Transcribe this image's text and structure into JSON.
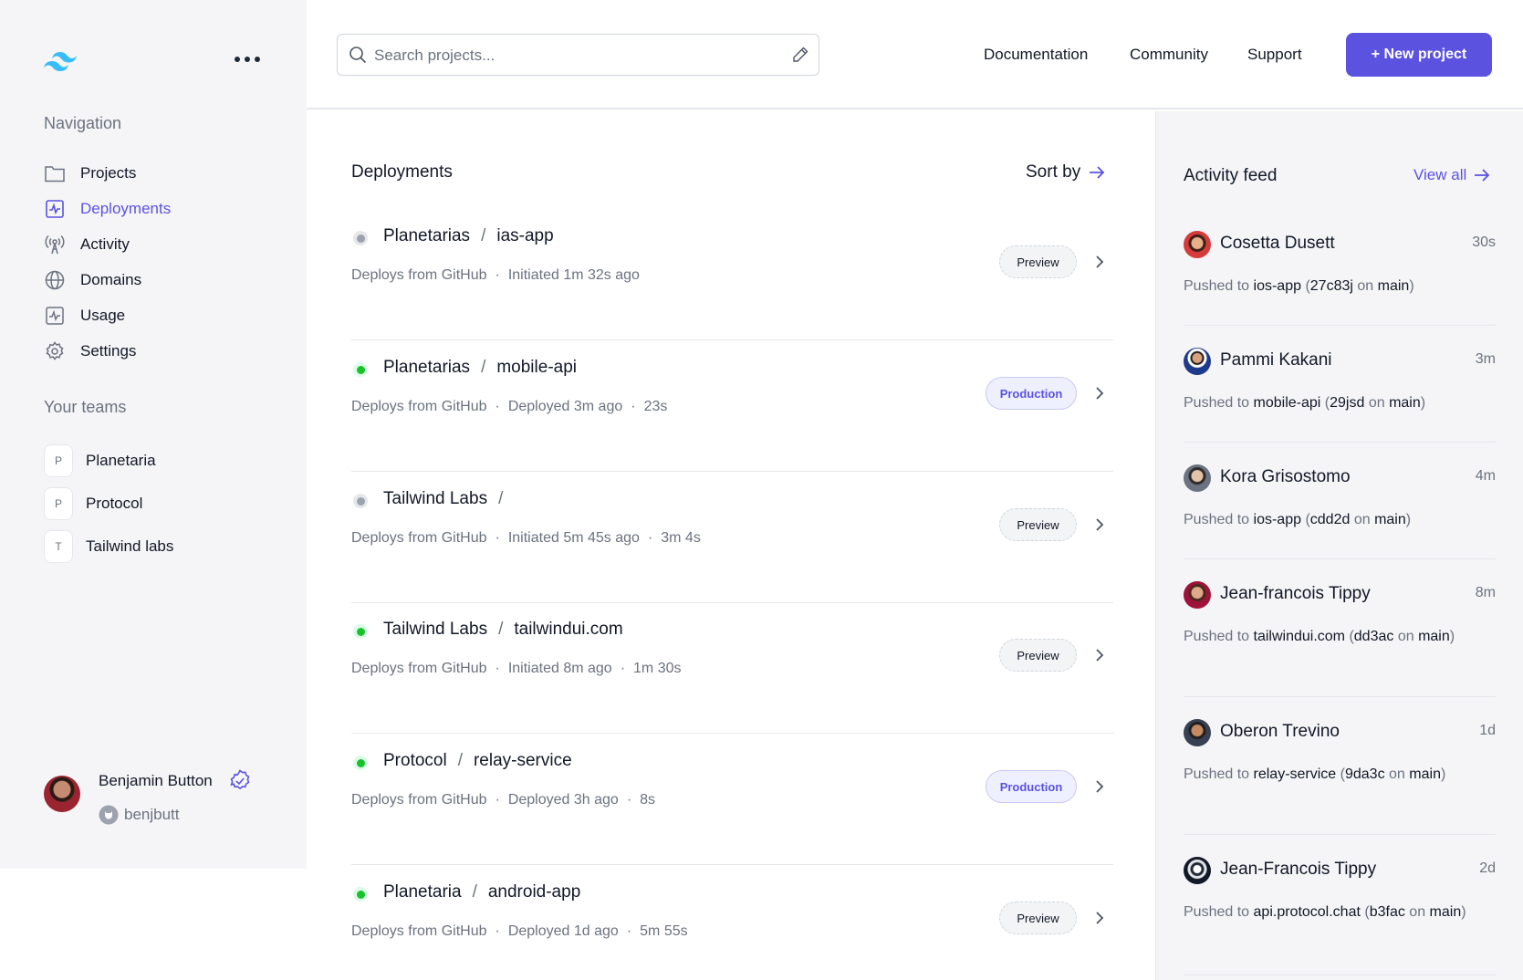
{
  "colors": {
    "accent": "#5b52e0",
    "status_green": "#16c329",
    "status_gray": "#9ca3af"
  },
  "sidebar": {
    "logo_icon": "tailwind-logo",
    "more_icon": "ellipsis-icon",
    "nav_heading": "Navigation",
    "nav": [
      {
        "label": "Projects",
        "icon": "folder-icon"
      },
      {
        "label": "Deployments",
        "icon": "pulse-icon",
        "active": true
      },
      {
        "label": "Activity",
        "icon": "signal-icon"
      },
      {
        "label": "Domains",
        "icon": "globe-icon"
      },
      {
        "label": "Usage",
        "icon": "chart-icon"
      },
      {
        "label": "Settings",
        "icon": "gear-icon"
      }
    ],
    "teams_heading": "Your teams",
    "teams": [
      {
        "initial": "P",
        "label": "Planetaria"
      },
      {
        "initial": "P",
        "label": "Protocol"
      },
      {
        "initial": "T",
        "label": "Tailwind labs"
      }
    ],
    "user": {
      "name": "Benjamin Button",
      "handle": "benjbutt"
    }
  },
  "header": {
    "search_placeholder": "Search projects...",
    "links": [
      "Documentation",
      "Community",
      "Support"
    ],
    "new_button": "+ New project"
  },
  "deployments": {
    "title": "Deployments",
    "sort_label": "Sort by",
    "rows": [
      {
        "team": "Planetarias",
        "project": "ias-app",
        "status": "gray",
        "meta": [
          "Deploys from GitHub",
          "Initiated 1m 32s ago"
        ],
        "badge": "Preview"
      },
      {
        "team": "Planetarias",
        "project": "mobile-api",
        "status": "green",
        "meta": [
          "Deploys from GitHub",
          "Deployed 3m ago",
          "23s"
        ],
        "badge": "Production"
      },
      {
        "team": "Tailwind Labs",
        "project": "",
        "status": "gray",
        "meta": [
          "Deploys from GitHub",
          "Initiated 5m 45s ago",
          "3m 4s"
        ],
        "badge": "Preview"
      },
      {
        "team": "Tailwind Labs",
        "project": "tailwindui.com",
        "status": "green",
        "meta": [
          "Deploys from GitHub",
          "Initiated 8m ago",
          "1m 30s"
        ],
        "badge": "Preview"
      },
      {
        "team": "Protocol",
        "project": "relay-service",
        "status": "green",
        "meta": [
          "Deploys from GitHub",
          "Deployed 3h ago",
          "8s"
        ],
        "badge": "Production"
      },
      {
        "team": "Planetaria",
        "project": "android-app",
        "status": "green",
        "meta": [
          "Deploys from GitHub",
          "Deployed 1d ago",
          "5m 55s"
        ],
        "badge": "Preview"
      }
    ]
  },
  "feed": {
    "title": "Activity feed",
    "view_all": "View all",
    "pushed_to": "Pushed to",
    "on": "on",
    "items": [
      {
        "name": "Cosetta Dusett",
        "time": "30s",
        "project": "ios-app",
        "commit": "27c83j",
        "branch": "main"
      },
      {
        "name": "Pammi Kakani",
        "time": "3m",
        "project": "mobile-api",
        "commit": "29jsd",
        "branch": "main"
      },
      {
        "name": "Kora Grisostomo",
        "time": "4m",
        "project": "ios-app",
        "commit": "cdd2d",
        "branch": "main"
      },
      {
        "name": "Jean-francois Tippy",
        "time": "8m",
        "project": "tailwindui.com",
        "commit": "dd3ac",
        "branch": "main"
      },
      {
        "name": "Oberon Trevino",
        "time": "1d",
        "project": "relay-service",
        "commit": "9da3c",
        "branch": "main"
      },
      {
        "name": "Jean-Francois Tippy",
        "time": "2d",
        "project": "api.protocol.chat",
        "commit": "b3fac",
        "branch": "main"
      }
    ]
  }
}
